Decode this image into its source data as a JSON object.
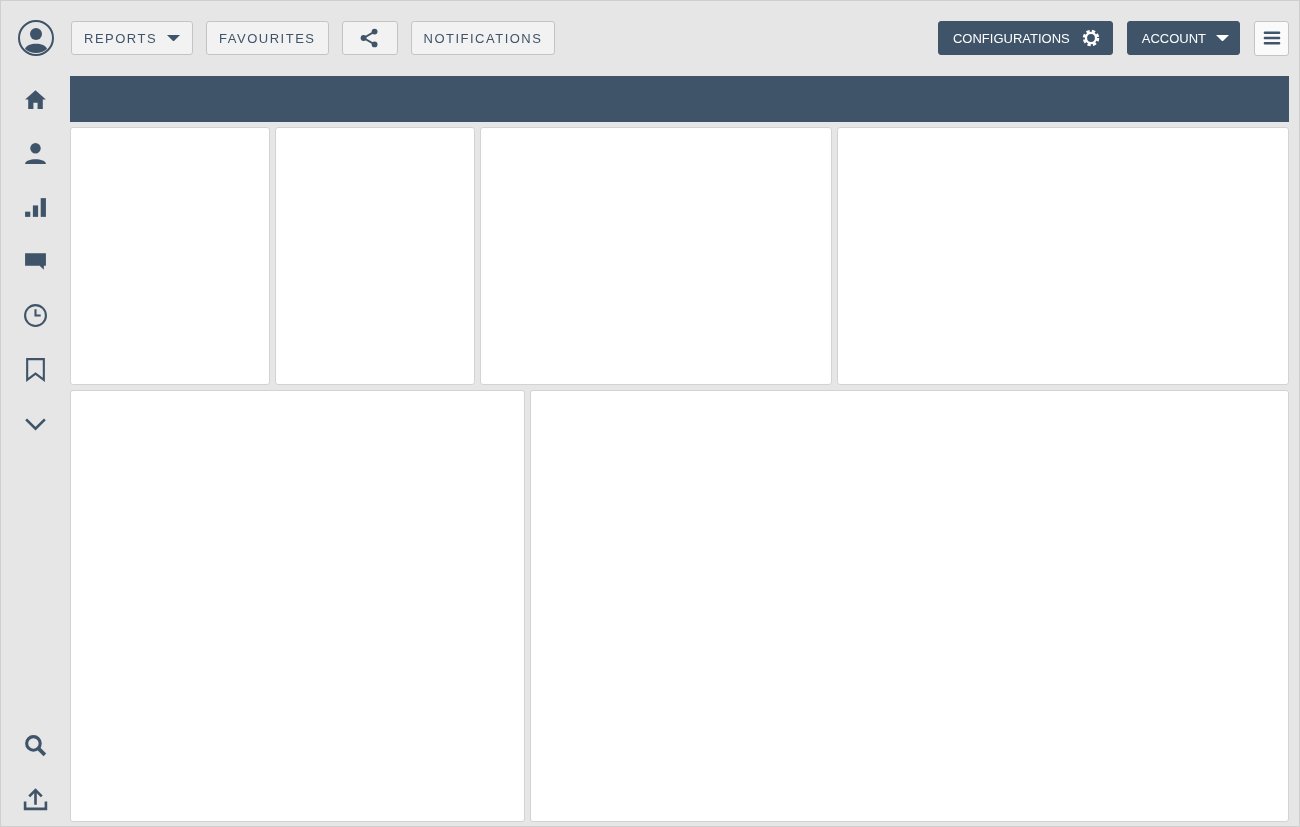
{
  "toolbar": {
    "left": [
      {
        "kind": "dropdown",
        "label": "REPORTS"
      },
      {
        "kind": "text",
        "label": "FAVOURITES"
      },
      {
        "kind": "share"
      },
      {
        "kind": "text",
        "label": "NOTIFICATIONS"
      }
    ],
    "right": [
      {
        "kind": "gear",
        "label": "CONFIGURATIONS"
      },
      {
        "kind": "dropdown",
        "label": "ACCOUNT"
      },
      {
        "kind": "menu"
      }
    ]
  },
  "sidebar": {
    "items": [
      {
        "kind": "home"
      },
      {
        "kind": "person"
      },
      {
        "kind": "chart"
      },
      {
        "kind": "comment"
      },
      {
        "kind": "clock"
      },
      {
        "kind": "bookmark"
      },
      {
        "kind": "chevron"
      }
    ],
    "bottom_items": [
      {
        "kind": "search"
      },
      {
        "kind": "upload"
      }
    ]
  }
}
